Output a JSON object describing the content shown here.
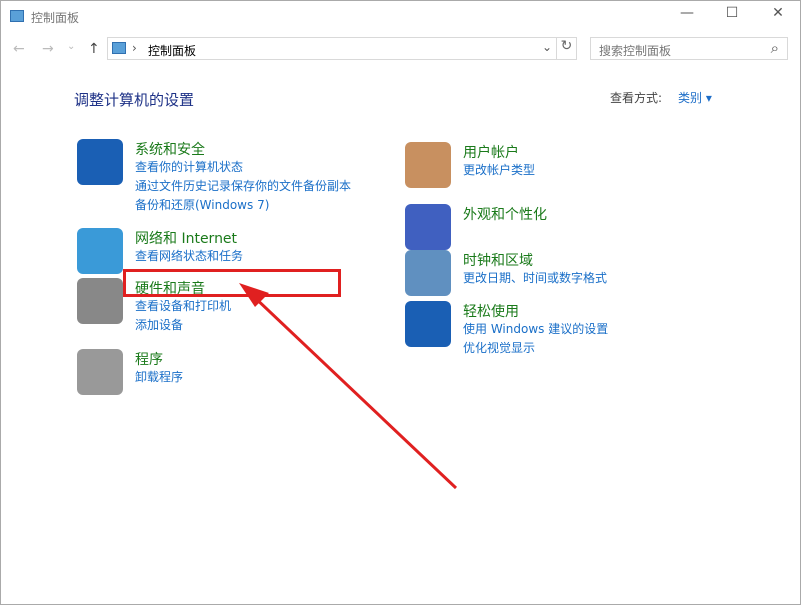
{
  "window": {
    "title": "控制面板",
    "minimize": "—",
    "maximize": "☐",
    "close": "✕"
  },
  "toolbar": {
    "back": "←",
    "forward": "→",
    "recent": "⌄",
    "up": "↑",
    "breadcrumb_sep": "›",
    "breadcrumb": "控制面板",
    "dropdown": "⌄",
    "refresh": "↻",
    "search_placeholder": "搜索控制面板",
    "search_icon": "⌕"
  },
  "main": {
    "heading": "调整计算机的设置",
    "view_label": "查看方式:",
    "view_value": "类别 ▾"
  },
  "left": [
    {
      "title": "系统和安全",
      "links": [
        "查看你的计算机状态",
        "通过文件历史记录保存你的文件备份副本",
        "备份和还原(Windows 7)"
      ],
      "color": "#1a5fb4"
    },
    {
      "title": "网络和 Internet",
      "links": [
        "查看网络状态和任务"
      ],
      "color": "#3a9ad8"
    },
    {
      "title": "硬件和声音",
      "links": [
        "查看设备和打印机",
        "添加设备"
      ],
      "color": "#888888"
    },
    {
      "title": "程序",
      "links": [
        "卸载程序"
      ],
      "color": "#999999"
    }
  ],
  "right": [
    {
      "title": "用户帐户",
      "links": [
        "更改帐户类型"
      ],
      "color": "#c89060"
    },
    {
      "title": "外观和个性化",
      "links": [],
      "color": "#4060c0"
    },
    {
      "title": "时钟和区域",
      "links": [
        "更改日期、时间或数字格式"
      ],
      "color": "#6090c0"
    },
    {
      "title": "轻松使用",
      "links": [
        "使用 Windows 建议的设置",
        "优化视觉显示"
      ],
      "color": "#1a5fb4"
    }
  ]
}
